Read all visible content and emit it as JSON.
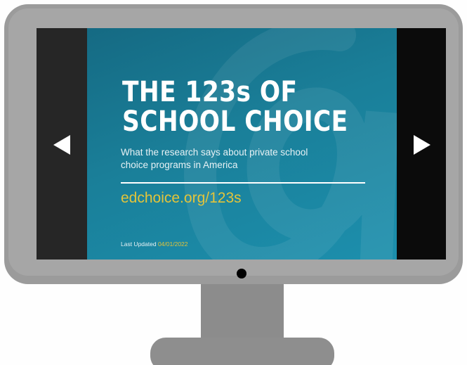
{
  "slide": {
    "title_line1": "THE 123s OF",
    "title_line2": "SCHOOL CHOICE",
    "subtitle_line1": "What the research says about private school",
    "subtitle_line2": "choice programs in America",
    "url": "edchoice.org/123s",
    "last_updated_label": "Last Updated",
    "last_updated_date": "04/01/2022"
  },
  "navigation": {
    "previous_icon": "triangle-left-icon",
    "next_icon": "triangle-right-icon"
  },
  "colors": {
    "slide_background": "#1a7f99",
    "accent_yellow": "#e3c43a",
    "bezel": "#9b9b9b",
    "stand": "#8c8c8c"
  }
}
